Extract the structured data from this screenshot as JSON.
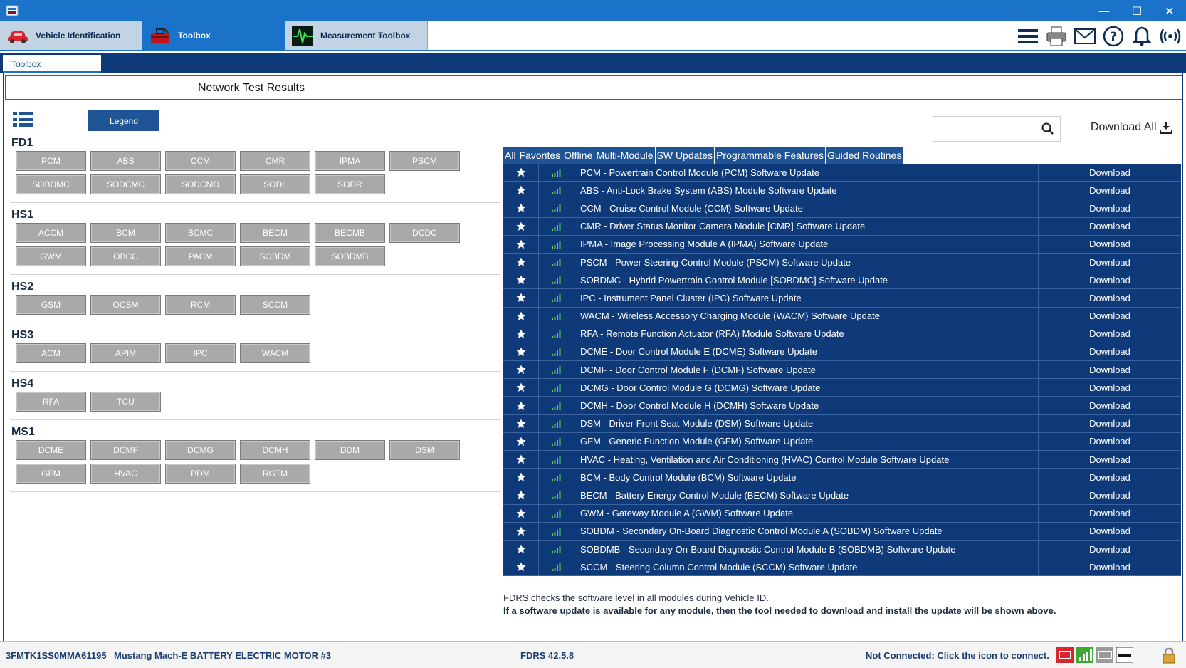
{
  "window": {
    "controls": {
      "minimize": "—",
      "maximize": "☐",
      "close": "✕"
    }
  },
  "main_tabs": [
    {
      "label": "Vehicle Identification",
      "icon": "car-icon"
    },
    {
      "label": "Toolbox",
      "icon": "toolbox-icon"
    },
    {
      "label": "Measurement Toolbox",
      "icon": "oscilloscope-icon"
    }
  ],
  "toolbar_icons": [
    "menu-icon",
    "printer-icon",
    "mail-icon",
    "help-icon",
    "bell-icon",
    "wireless-icon"
  ],
  "subtab": {
    "label": "Toolbox"
  },
  "page": {
    "title": "Network Test Results"
  },
  "legend_button": "Legend",
  "network_groups": [
    {
      "name": "FD1",
      "modules": [
        "PCM",
        "ABS",
        "CCM",
        "CMR",
        "IPMA",
        "PSCM",
        "SOBDMC",
        "SODCMC",
        "SODCMD",
        "SODL",
        "SODR"
      ]
    },
    {
      "name": "HS1",
      "modules": [
        "ACCM",
        "BCM",
        "BCMC",
        "BECM",
        "BECMB",
        "DCDC",
        "GWM",
        "OBCC",
        "PACM",
        "SOBDM",
        "SOBDMB"
      ]
    },
    {
      "name": "HS2",
      "modules": [
        "GSM",
        "OCSM",
        "RCM",
        "SCCM"
      ]
    },
    {
      "name": "HS3",
      "modules": [
        "ACM",
        "APIM",
        "IPC",
        "WACM"
      ]
    },
    {
      "name": "HS4",
      "modules": [
        "RFA",
        "TCU"
      ]
    },
    {
      "name": "MS1",
      "modules": [
        "DCME",
        "DCMF",
        "DCMG",
        "DCMH",
        "DDM",
        "DSM",
        "GFM",
        "HVAC",
        "PDM",
        "RGTM"
      ]
    }
  ],
  "search": {
    "value": "",
    "placeholder": ""
  },
  "download_all": "Download All",
  "filter_tabs": [
    "All",
    "Favorites",
    "Offline",
    "Multi-Module",
    "SW Updates",
    "Programmable Features",
    "Guided Routines"
  ],
  "updates": [
    {
      "desc": "PCM - Powertrain Control Module (PCM) Software Update",
      "action": "Download"
    },
    {
      "desc": "ABS - Anti-Lock Brake System (ABS) Module Software Update",
      "action": "Download"
    },
    {
      "desc": "CCM - Cruise Control Module (CCM) Software Update",
      "action": "Download"
    },
    {
      "desc": "CMR - Driver Status Monitor Camera Module [CMR] Software Update",
      "action": "Download"
    },
    {
      "desc": "IPMA - Image Processing Module A (IPMA) Software Update",
      "action": "Download"
    },
    {
      "desc": "PSCM - Power Steering Control Module (PSCM) Software Update",
      "action": "Download"
    },
    {
      "desc": "SOBDMC - Hybrid Powertrain Control Module [SOBDMC] Software Update",
      "action": "Download"
    },
    {
      "desc": "IPC - Instrument Panel Cluster (IPC) Software Update",
      "action": "Download"
    },
    {
      "desc": "WACM - Wireless Accessory Charging Module (WACM) Software Update",
      "action": "Download"
    },
    {
      "desc": "RFA - Remote Function Actuator (RFA) Module Software Update",
      "action": "Download"
    },
    {
      "desc": "DCME - Door Control Module E (DCME) Software Update",
      "action": "Download"
    },
    {
      "desc": "DCMF - Door Control Module F (DCMF) Software Update",
      "action": "Download"
    },
    {
      "desc": "DCMG - Door Control Module G (DCMG) Software Update",
      "action": "Download"
    },
    {
      "desc": "DCMH - Door Control Module H (DCMH) Software Update",
      "action": "Download"
    },
    {
      "desc": "DSM - Driver Front Seat Module (DSM) Software Update",
      "action": "Download"
    },
    {
      "desc": "GFM - Generic Function Module (GFM) Software Update",
      "action": "Download"
    },
    {
      "desc": "HVAC - Heating, Ventilation and Air Conditioning (HVAC) Control Module Software Update",
      "action": "Download"
    },
    {
      "desc": "BCM - Body Control Module (BCM) Software Update",
      "action": "Download"
    },
    {
      "desc": "BECM - Battery Energy Control Module (BECM) Software Update",
      "action": "Download"
    },
    {
      "desc": "GWM - Gateway Module A (GWM) Software Update",
      "action": "Download"
    },
    {
      "desc": "SOBDM - Secondary On-Board Diagnostic Control Module A (SOBDM) Software Update",
      "action": "Download"
    },
    {
      "desc": "SOBDMB - Secondary On-Board Diagnostic Control Module B (SOBDMB) Software Update",
      "action": "Download"
    },
    {
      "desc": "SCCM - Steering Column Control Module (SCCM) Software Update",
      "action": "Download"
    }
  ],
  "notes": {
    "line1": "FDRS checks the software level in all modules during Vehicle ID.",
    "line2": "If a software update is available for any module, then the tool needed to download and install the update will be shown above."
  },
  "statusbar": {
    "vin": "3FMTK1SS0MMA61195",
    "vehicle": "Mustang Mach-E BATTERY ELECTRIC MOTOR #3",
    "version": "FDRS 42.5.8",
    "connection": "Not Connected: Click the icon to connect."
  },
  "colors": {
    "accent": "#1a73c9",
    "navy": "#0f3a7a",
    "signal_green": "#5fd14a"
  }
}
